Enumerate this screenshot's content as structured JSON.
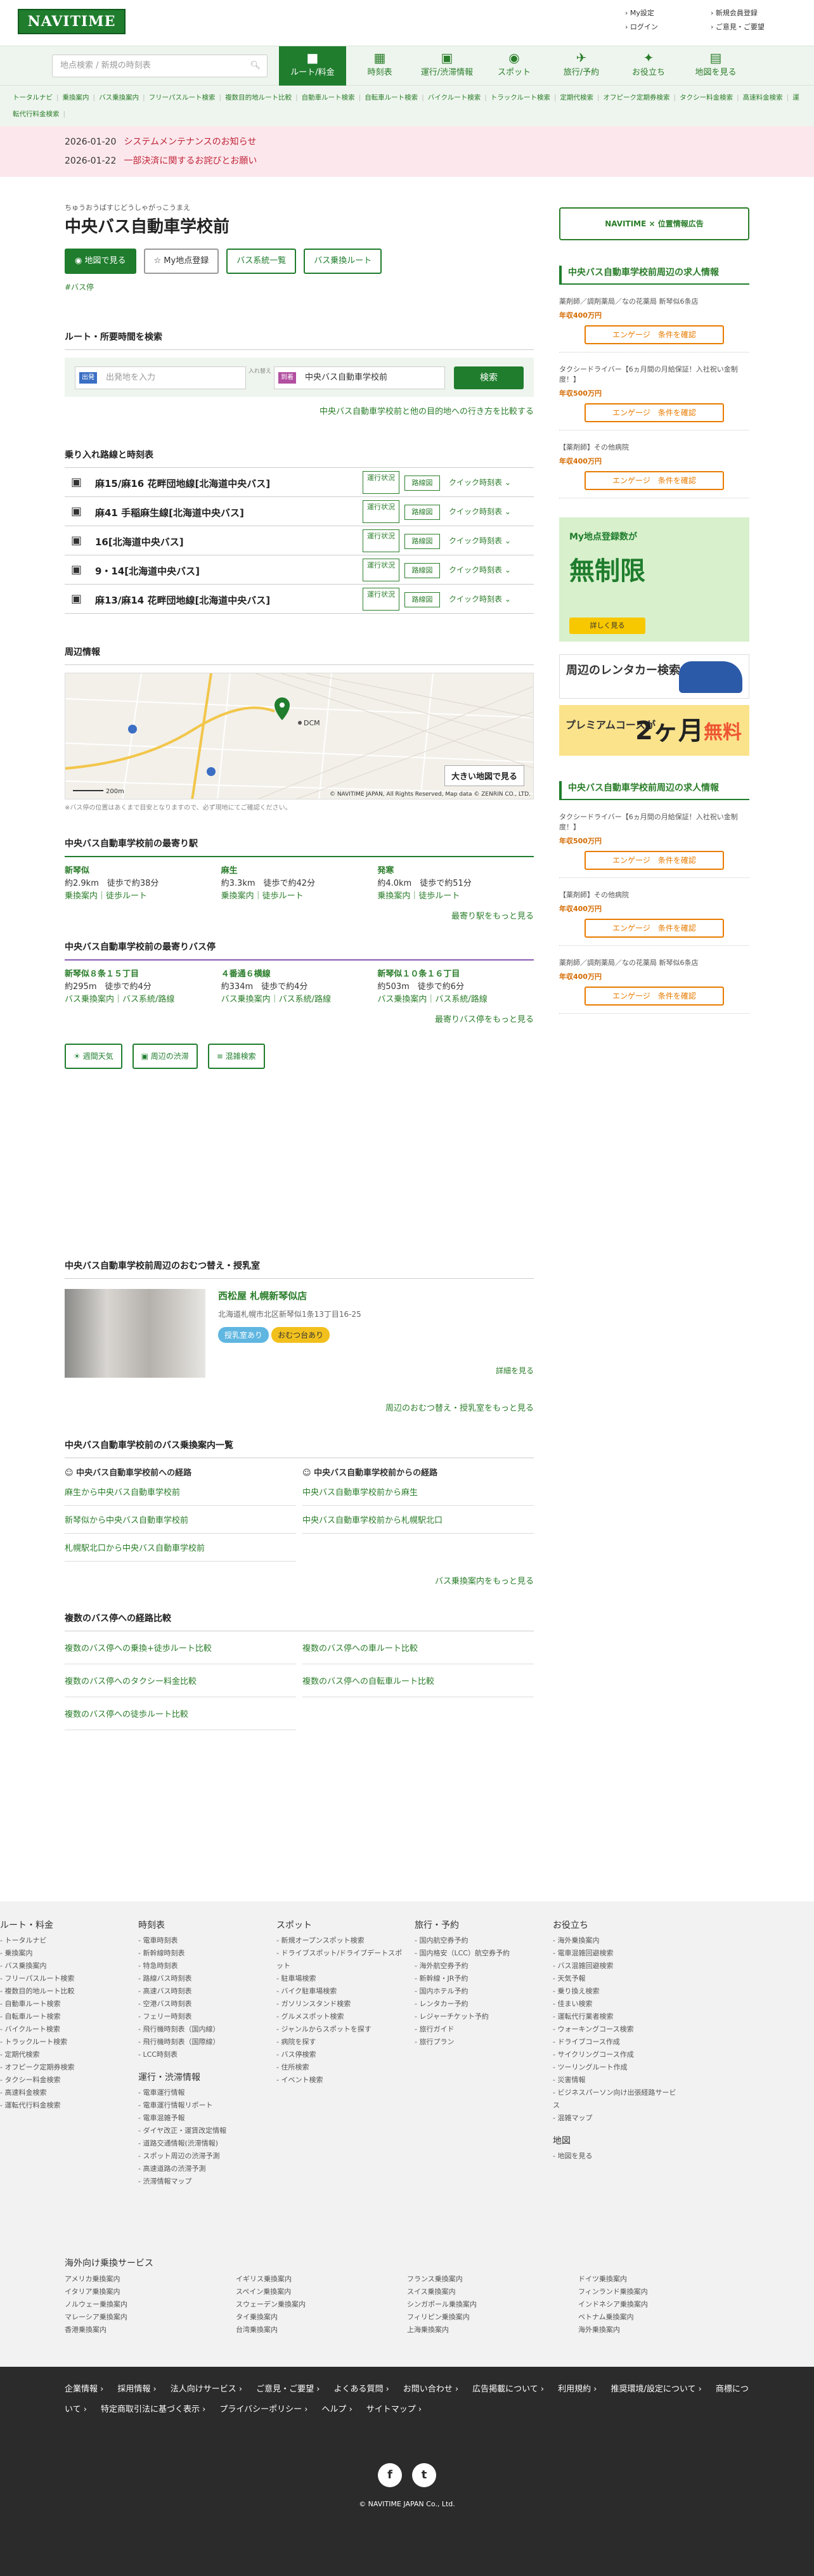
{
  "header": {
    "logo": "NAVITIME",
    "links": [
      "My設定",
      "新規会員登録",
      "ログイン",
      "ご意見・ご要望"
    ]
  },
  "search": {
    "placeholder": "地点検索 / 新規の時刻表"
  },
  "nav": [
    {
      "icon": "route-icon",
      "label": "ルート/料金"
    },
    {
      "icon": "timetable-icon",
      "label": "時刻表"
    },
    {
      "icon": "traffic-icon",
      "label": "運行/渋滞情報"
    },
    {
      "icon": "spot-icon",
      "label": "スポット"
    },
    {
      "icon": "travel-icon",
      "label": "旅行/予約"
    },
    {
      "icon": "useful-icon",
      "label": "お役立ち"
    },
    {
      "icon": "map-icon",
      "label": "地図を見る"
    }
  ],
  "subnav": [
    "トータルナビ",
    "乗換案内",
    "バス乗換案内",
    "フリーパスルート検索",
    "複数目的地ルート比較",
    "自動車ルート検索",
    "自転車ルート検索",
    "バイクルート検索",
    "トラックルート検索",
    "定期代検索",
    "オフピーク定期券検索",
    "タクシー料金検索",
    "高速料金検索",
    "運転代行料金検索"
  ],
  "notices": [
    {
      "date": "2026-01-20",
      "text": "システムメンテナンスのお知らせ"
    },
    {
      "date": "2026-01-22",
      "text": "一部決済に関するお詫びとお願い"
    }
  ],
  "page": {
    "ruby": "ちゅうおうばすじどうしゃがっこうまえ",
    "title": "中央バス自動車学校前",
    "buttons": [
      "地図で見る",
      "My地点登録",
      "バス系統一覧",
      "バス乗換ルート"
    ],
    "tag": "#バス停"
  },
  "routesearch": {
    "heading": "ルート・所要時間を検索",
    "from_label": "出発",
    "from_placeholder": "出発地を入力",
    "swap": "入れ替え",
    "to_label": "到着",
    "to_value": "中央バス自動車学校前",
    "button": "検索",
    "link": "中央バス自動車学校前と他の目的地への行き方を比較する"
  },
  "lines": {
    "heading": "乗り入れ路線と時刻表",
    "op": "運行状況",
    "dd": "路線図",
    "qt": "クイック時刻表",
    "items": [
      "麻15/麻16 花畔団地線[北海道中央バス]",
      "麻41 手稲麻生線[北海道中央バス]",
      "16[北海道中央バス]",
      "9・14[北海道中央バス]",
      "麻13/麻14 花畔団地線[北海道中央バス]"
    ]
  },
  "nearby": {
    "heading": "周辺情報",
    "big": "大きい地図で見る",
    "copy": "© NAVITIME JAPAN, All Rights Reserved, Map data © ZENRIN CO., LTD.",
    "note": "※バス停の位置はあくまで目安となりますので、必ず現地にてご確認ください。",
    "scale": "200m",
    "label": "DCM"
  },
  "stations": {
    "heading": "中央バス自動車学校前の最寄り駅",
    "items": [
      {
        "name": "新琴似",
        "dist": "約2.9km　徒歩で約38分",
        "links": "乗換案内｜徒歩ルート"
      },
      {
        "name": "麻生",
        "dist": "約3.3km　徒歩で約42分",
        "links": "乗換案内｜徒歩ルート"
      },
      {
        "name": "発寒",
        "dist": "約4.0km　徒歩で約51分",
        "links": "乗換案内｜徒歩ルート"
      }
    ],
    "more": "最寄り駅をもっと見る"
  },
  "stops": {
    "heading": "中央バス自動車学校前の最寄りバス停",
    "items": [
      {
        "name": "新琴似８条１５丁目",
        "dist": "約295m　徒歩で約4分",
        "links": "バス乗換案内｜バス系統/路線"
      },
      {
        "name": "４番通６横線",
        "dist": "約334m　徒歩で約4分",
        "links": "バス乗換案内｜バス系統/路線"
      },
      {
        "name": "新琴似１０条１６丁目",
        "dist": "約503m　徒歩で約6分",
        "links": "バス乗換案内｜バス系統/路線"
      }
    ],
    "more": "最寄りバス停をもっと見る"
  },
  "chips": [
    "週間天気",
    "周辺の渋滞",
    "混雑検索"
  ],
  "nursing": {
    "heading": "中央バス自動車学校前周辺のおむつ替え・授乳室",
    "name": "西松屋 札幌新琴似店",
    "addr": "北海道札幌市北区新琴似1条13丁目16-25",
    "b1": "授乳室あり",
    "b2": "おむつ台あり",
    "detail": "詳細を見る",
    "more": "周辺のおむつ替え・授乳室をもっと見る"
  },
  "busroutes": {
    "heading": "中央バス自動車学校前のバス乗換案内一覧",
    "to": "中央バス自動車学校前への経路",
    "from": "中央バス自動車学校前からの経路",
    "tolinks": [
      "麻生から中央バス自動車学校前",
      "新琴似から中央バス自動車学校前",
      "札幌駅北口から中央バス自動車学校前"
    ],
    "fromlinks": [
      "中央バス自動車学校前から麻生",
      "中央バス自動車学校前から札幌駅北口"
    ],
    "more": "バス乗換案内をもっと見る"
  },
  "compare": {
    "heading": "複数のバス停への経路比較",
    "items": [
      "複数のバス停への乗換+徒歩ルート比較",
      "複数のバス停への車ルート比較",
      "複数のバス停へのタクシー料金比較",
      "複数のバス停への自転車ルート比較",
      "複数のバス停への徒歩ルート比較"
    ]
  },
  "side": {
    "ad": "NAVITIME × 位置情報広告",
    "jobs_heading": "中央バス自動車学校前周辺の求人情報",
    "jobs": [
      {
        "t": "薬剤師／調剤薬局／なの花薬局 新琴似6条店",
        "s": "年収400万円"
      },
      {
        "t": "タクシードライバー【6ヵ月間の月給保証！入社祝い金制度！】",
        "s": "年収500万円"
      },
      {
        "t": "【薬剤師】その他病院",
        "s": "年収400万円"
      }
    ],
    "apply": "エンゲージ　条件を確認",
    "bnr1_s": "My地点登録数が",
    "bnr1_b": "無制限",
    "bnr1_c": "詳しく見る",
    "bnr2": "周辺のレンタカー検索",
    "bnr3_t": "プレミアムコースが",
    "bnr3_n": "2ヶ月",
    "bnr3_f": "無料",
    "jobs2_heading": "中央バス自動車学校前周辺の求人情報",
    "jobs2": [
      {
        "t": "タクシードライバー【6ヵ月間の月給保証！入社祝い金制度！】",
        "s": "年収500万円"
      },
      {
        "t": "【薬剤師】その他病院",
        "s": "年収400万円"
      },
      {
        "t": "薬剤師／調剤薬局／なの花薬局 新琴似6条店",
        "s": "年収400万円"
      }
    ]
  },
  "footer": {
    "cols": [
      {
        "h": "ルート・料金",
        "i": [
          "トータルナビ",
          "乗換案内",
          "バス乗換案内",
          "フリーパスルート検索",
          "複数目的地ルート比較",
          "自動車ルート検索",
          "自転車ルート検索",
          "バイクルート検索",
          "トラックルート検索",
          "定期代検索",
          "オフピーク定期券検索",
          "タクシー料金検索",
          "高速料金検索",
          "運転代行料金検索"
        ]
      },
      {
        "h": "時刻表",
        "i": [
          "電車時刻表",
          "新幹線時刻表",
          "特急時刻表",
          "路線バス時刻表",
          "高速バス時刻表",
          "空港バス時刻表",
          "フェリー時刻表",
          "飛行機時刻表（国内線）",
          "飛行機時刻表（国際線）",
          "LCC時刻表"
        ]
      },
      {
        "h": "スポット",
        "i": [
          "新規オープンスポット検索",
          "ドライブスポット/ドライブデートスポット",
          "駐車場検索",
          "バイク駐車場検索",
          "ガソリンスタンド検索",
          "グルメスポット検索",
          "ジャンルからスポットを探す",
          "病院を探す",
          "バス停検索",
          "住所検索",
          "イベント検索"
        ]
      },
      {
        "h": "旅行・予約",
        "i": [
          "国内航空券予約",
          "国内格安（LCC）航空券予約",
          "海外航空券予約",
          "新幹線・JR予約",
          "国内ホテル予約",
          "レンタカー予約",
          "レジャーチケット予約",
          "旅行ガイド",
          "旅行プラン"
        ]
      },
      {
        "h": "お役立ち",
        "i": [
          "海外乗換案内",
          "電車混雑回避検索",
          "バス混雑回避検索",
          "天気予報",
          "乗り換え検索",
          "佳まい検索",
          "運転代行業者検索",
          "ウォーキングコース検索",
          "ドライブコース作成",
          "サイクリングコース作成",
          "ツーリングルート作成",
          "災害情報",
          "ビジネスパーソン向け出張経路サービス",
          "混雑マップ"
        ]
      }
    ],
    "col2b": {
      "h": "運行・渋滞情報",
      "i": [
        "電車運行情報",
        "電車運行情報リポート",
        "電車混雑予報",
        "ダイヤ改正・運賃改定情報",
        "道路交通情報(渋滞情報)",
        "スポット周辺の渋滞予測",
        "高速道路の渋滞予測",
        "渋滞情報マップ"
      ]
    },
    "col5b": {
      "h": "地図",
      "i": [
        "地図を見る"
      ]
    },
    "abroad_h": "海外向け乗換サービス",
    "abroad": [
      "アメリカ乗換案内",
      "イギリス乗換案内",
      "フランス乗換案内",
      "ドイツ乗換案内",
      "イタリア乗換案内",
      "スペイン乗換案内",
      "スイス乗換案内",
      "フィンランド乗換案内",
      "ノルウェー乗換案内",
      "スウェーデン乗換案内",
      "シンガポール乗換案内",
      "インドネシア乗換案内",
      "マレーシア乗換案内",
      "タイ乗換案内",
      "フィリピン乗換案内",
      "ベトナム乗換案内",
      "香港乗換案内",
      "台湾乗換案内",
      "上海乗換案内",
      "海外乗換案内"
    ],
    "dark": [
      "企業情報",
      "採用情報",
      "法人向けサービス",
      "ご意見・ご要望",
      "よくある質問",
      "お問い合わせ",
      "広告掲載について",
      "利用規約",
      "推奨環境/設定について",
      "商標について",
      "特定商取引法に基づく表示",
      "プライバシーポリシー",
      "ヘルプ",
      "サイトマップ"
    ],
    "copyright": "© NAVITIME JAPAN Co., Ltd."
  }
}
